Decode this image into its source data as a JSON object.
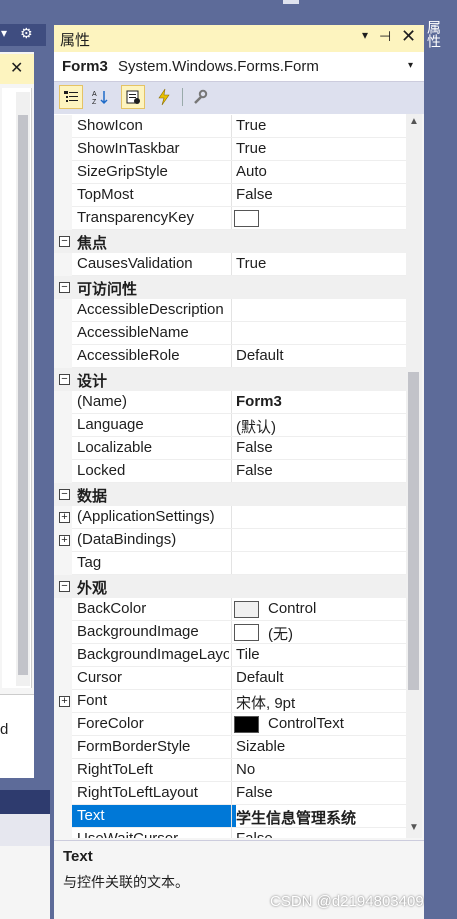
{
  "window": {
    "title": "属性",
    "controls": {
      "dropdown": "▾",
      "pin": "⊣",
      "close": "✕"
    },
    "side_tab": "属性"
  },
  "object_selector": {
    "name": "Form3",
    "type": "System.Windows.Forms.Form",
    "arrow": "▾"
  },
  "left_panel": {
    "header_symbols": [
      "▾",
      "⚙"
    ],
    "close_symbol": "✕",
    "fragment_text": "d"
  },
  "rows": [
    {
      "kind": "prop",
      "name": "ShowIcon",
      "value": "True"
    },
    {
      "kind": "prop",
      "name": "ShowInTaskbar",
      "value": "True"
    },
    {
      "kind": "prop",
      "name": "SizeGripStyle",
      "value": "Auto"
    },
    {
      "kind": "prop",
      "name": "TopMost",
      "value": "False"
    },
    {
      "kind": "prop",
      "name": "TransparencyKey",
      "value": "",
      "swatch": "#ffffff"
    },
    {
      "kind": "cat",
      "name": "焦点",
      "toggle": "⊟"
    },
    {
      "kind": "prop",
      "name": "CausesValidation",
      "value": "True"
    },
    {
      "kind": "cat",
      "name": "可访问性",
      "toggle": "⊟"
    },
    {
      "kind": "prop",
      "name": "AccessibleDescription",
      "value": ""
    },
    {
      "kind": "prop",
      "name": "AccessibleName",
      "value": ""
    },
    {
      "kind": "prop",
      "name": "AccessibleRole",
      "value": "Default"
    },
    {
      "kind": "cat",
      "name": "设计",
      "toggle": "⊟"
    },
    {
      "kind": "prop",
      "name": "(Name)",
      "value": "Form3",
      "bold": true
    },
    {
      "kind": "prop",
      "name": "Language",
      "value": "(默认)"
    },
    {
      "kind": "prop",
      "name": "Localizable",
      "value": "False"
    },
    {
      "kind": "prop",
      "name": "Locked",
      "value": "False"
    },
    {
      "kind": "cat",
      "name": "数据",
      "toggle": "⊟"
    },
    {
      "kind": "prop",
      "name": "(ApplicationSettings)",
      "value": "",
      "expand": "+"
    },
    {
      "kind": "prop",
      "name": "(DataBindings)",
      "value": "",
      "expand": "+"
    },
    {
      "kind": "prop",
      "name": "Tag",
      "value": ""
    },
    {
      "kind": "cat",
      "name": "外观",
      "toggle": "⊟"
    },
    {
      "kind": "prop",
      "name": "BackColor",
      "value": "Control",
      "swatch": "#f0f0f0"
    },
    {
      "kind": "prop",
      "name": "BackgroundImage",
      "value": "(无)",
      "swatch": "#ffffff"
    },
    {
      "kind": "prop",
      "name": "BackgroundImageLayout",
      "value": "Tile"
    },
    {
      "kind": "prop",
      "name": "Cursor",
      "value": "Default"
    },
    {
      "kind": "prop",
      "name": "Font",
      "value": "宋体, 9pt",
      "expand": "+"
    },
    {
      "kind": "prop",
      "name": "ForeColor",
      "value": "ControlText",
      "swatch": "#000000"
    },
    {
      "kind": "prop",
      "name": "FormBorderStyle",
      "value": "Sizable"
    },
    {
      "kind": "prop",
      "name": "RightToLeft",
      "value": "No"
    },
    {
      "kind": "prop",
      "name": "RightToLeftLayout",
      "value": "False"
    },
    {
      "kind": "prop",
      "name": "Text",
      "value": "学生信息管理系统",
      "bold": true,
      "selected": true
    },
    {
      "kind": "prop",
      "name": "UseWaitCursor",
      "value": "False"
    }
  ],
  "description": {
    "title": "Text",
    "text": "与控件关联的文本。"
  },
  "watermark": "CSDN @d2194803409",
  "colors": {
    "selection": "#0078d7",
    "title_bar": "#fdf4bf",
    "frame": "#5d6b99"
  }
}
